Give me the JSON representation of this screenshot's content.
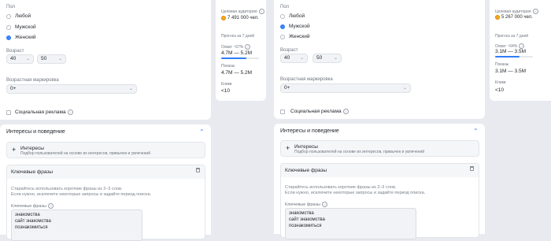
{
  "panels": [
    {
      "gender": {
        "label": "Пол",
        "options": [
          "Любой",
          "Мужской",
          "Женский"
        ],
        "selected_index": 2
      },
      "age": {
        "label": "Возраст",
        "from": "40",
        "to": "50"
      },
      "age_marking": {
        "label": "Возрастная маркировка",
        "value": "0+"
      },
      "social_ad": {
        "label": "Социальная реклама",
        "checked": false
      },
      "stats": {
        "audience_label": "Целевая аудитория",
        "audience_value": "7 491 000 чел.",
        "forecast_label": "Прогноз за 7 дней",
        "reach_label": "Охват ~67%",
        "reach_fraction": 0.67,
        "reach_value": "4.7M — 5.2M",
        "impressions_label": "Показы",
        "impressions_value": "4.7M — 5.2M",
        "clicks_label": "Клики",
        "clicks_value": "<10"
      },
      "interests": {
        "section_title": "Интересы и поведение",
        "item_title": "Интересы",
        "item_desc": "Подбор пользователей на основе их интересов, привычек и увлечений"
      },
      "keywords": {
        "title": "Ключевые фразы",
        "hint_line1": "Старайтесь использовать короткие фразы из 2–3 слов.",
        "hint_line2": "Если нужно, исключите некоторые запросы и задайте период поиска.",
        "field_label": "Ключевые фразы",
        "phrases": [
          "знакомства",
          "сайт знакомства",
          "познакомиться"
        ]
      }
    },
    {
      "gender": {
        "label": "Пол",
        "options": [
          "Любой",
          "Мужской",
          "Женский"
        ],
        "selected_index": 1
      },
      "age": {
        "label": "Возраст",
        "from": "40",
        "to": "50"
      },
      "age_marking": {
        "label": "Возрастная маркировка",
        "value": "0+"
      },
      "social_ad": {
        "label": "Социальная реклама",
        "checked": false
      },
      "stats": {
        "audience_label": "Целевая аудитория",
        "audience_value": "5 267 000 чел.",
        "forecast_label": "Прогноз за 7 дней",
        "reach_label": "Охват ~64%",
        "reach_fraction": 0.64,
        "reach_value": "3.1M — 3.5M",
        "impressions_label": "Показы",
        "impressions_value": "3.1M — 3.5M",
        "clicks_label": "Клики",
        "clicks_value": "<10"
      },
      "interests": {
        "section_title": "Интересы и поведение",
        "item_title": "Интересы",
        "item_desc": "Подбор пользователей на основе их интересов, привычек и увлечений"
      },
      "keywords": {
        "title": "Ключевые фразы",
        "hint_line1": "Старайтесь использовать короткие фразы из 2–3 слов.",
        "hint_line2": "Если нужно, исключите некоторые запросы и задайте период поиска.",
        "field_label": "Ключевые фразы",
        "phrases": [
          "знакомства",
          "сайт знакомства",
          "познакомиться"
        ]
      }
    }
  ],
  "colors": {
    "accent": "#2f7ef7",
    "coin": "#f5a623",
    "background": "#e8eaef"
  },
  "icons": {
    "info": "info-icon",
    "chevron": "chevron-down-icon",
    "collapse": "chevron-up-icon",
    "add": "plus-icon",
    "delete": "trash-icon",
    "coin": "coin-icon"
  }
}
